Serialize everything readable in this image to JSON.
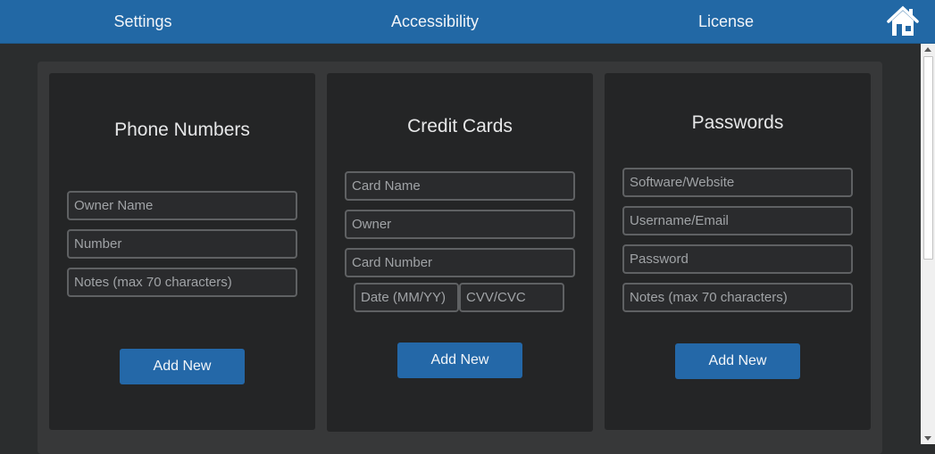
{
  "nav": {
    "settings": "Settings",
    "accessibility": "Accessibility",
    "license": "License",
    "home_icon": "home-icon"
  },
  "colors": {
    "topbar": "#2268a5",
    "background": "#2b2d2e",
    "card": "#242526",
    "button": "#2468a8"
  },
  "phone_numbers": {
    "title": "Phone Numbers",
    "owner_name_placeholder": "Owner Name",
    "number_placeholder": "Number",
    "notes_placeholder": "Notes (max 70 characters)",
    "add_label": "Add New"
  },
  "credit_cards": {
    "title": "Credit Cards",
    "card_name_placeholder": "Card Name",
    "owner_placeholder": "Owner",
    "card_number_placeholder": "Card Number",
    "date_placeholder": "Date (MM/YY)",
    "cvv_placeholder": "CVV/CVC",
    "add_label": "Add New"
  },
  "passwords": {
    "title": "Passwords",
    "software_placeholder": "Software/Website",
    "username_placeholder": "Username/Email",
    "password_placeholder": "Password",
    "notes_placeholder": "Notes (max 70 characters)",
    "add_label": "Add New"
  }
}
